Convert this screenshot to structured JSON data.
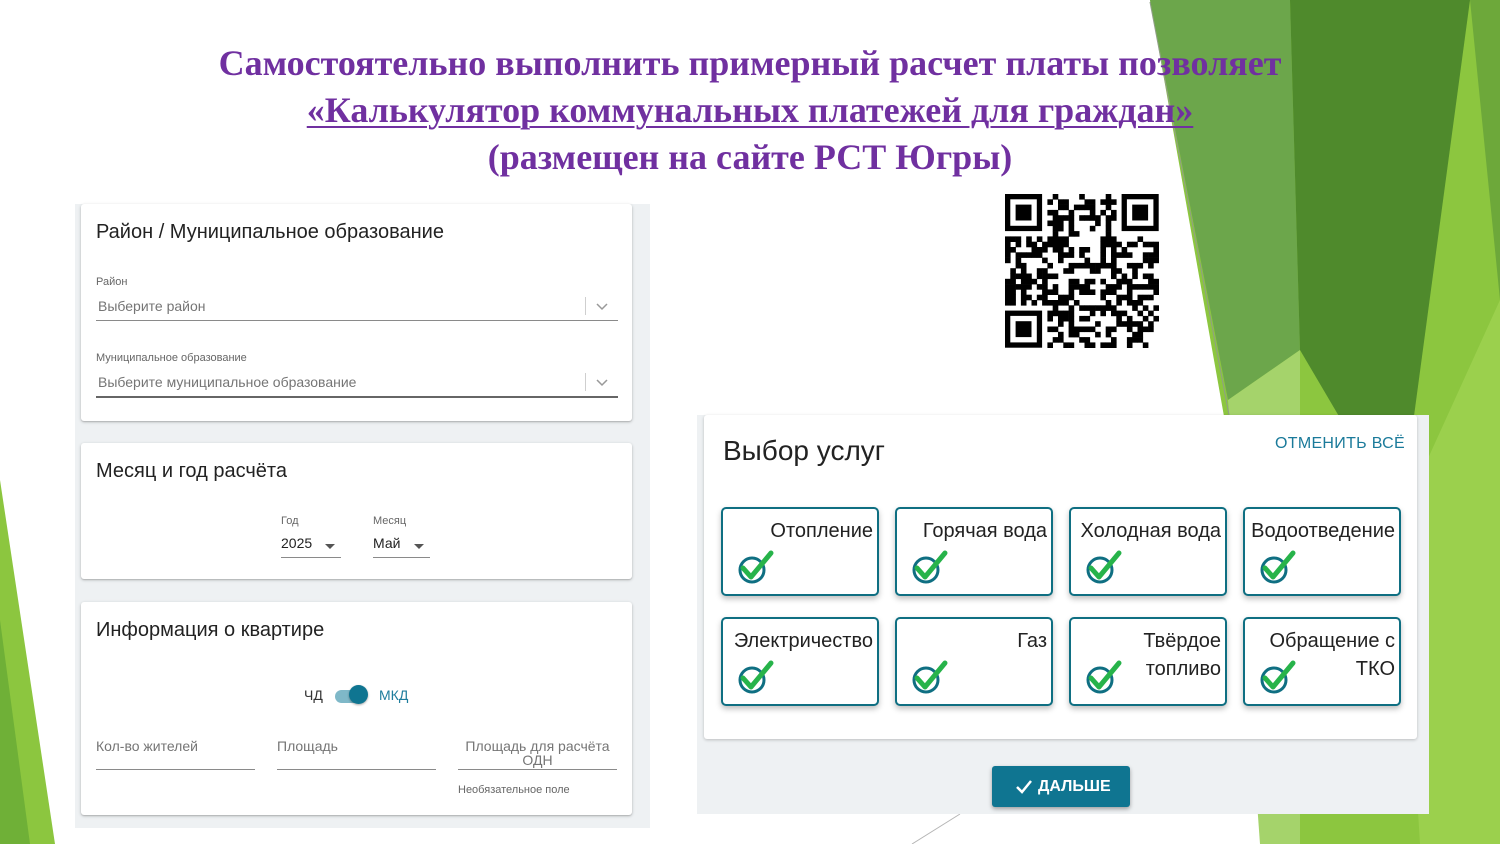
{
  "slide": {
    "title_line1": "Самостоятельно выполнить примерный расчет платы позволяет",
    "title_link": "«Калькулятор коммунальных платежей для граждан»",
    "title_line3": "(размещен на сайте РСТ Югры)",
    "colors": {
      "title": "#7030a0",
      "accent_green": "#8cc63f",
      "dark_green": "#4f8a2c"
    }
  },
  "district_section": {
    "title": "Район / Муниципальное образование",
    "district": {
      "label": "Район",
      "placeholder": "Выберите район"
    },
    "municipality": {
      "label": "Муниципальное образование",
      "placeholder": "Выберите муниципальное образование"
    }
  },
  "period_section": {
    "title": "Месяц и год расчёта",
    "year": {
      "label": "Год",
      "value": "2025"
    },
    "month": {
      "label": "Месяц",
      "value": "Май"
    }
  },
  "apartment_section": {
    "title": "Информация о квартире",
    "toggle": {
      "left_label": "ЧД",
      "right_label": "МКД",
      "selected": "МКД"
    },
    "residents": {
      "label": "Кол-во жителей",
      "value": ""
    },
    "area": {
      "label": "Площадь",
      "value": ""
    },
    "odn_area": {
      "label": "Площадь для расчёта ОДН",
      "value": "",
      "hint": "Необязательное поле"
    }
  },
  "services": {
    "title": "Выбор услуг",
    "cancel_all": "ОТМЕНИТЬ ВСЁ",
    "items": [
      {
        "label": "Отопление",
        "checked": true
      },
      {
        "label": "Горячая вода",
        "checked": true
      },
      {
        "label": "Холодная вода",
        "checked": true
      },
      {
        "label": "Водоотведение",
        "checked": true
      },
      {
        "label": "Электричество",
        "checked": true
      },
      {
        "label": "Газ",
        "checked": true
      },
      {
        "label": "Твёрдое топливо",
        "checked": true
      },
      {
        "label": "Обращение с ТКО",
        "checked": true
      }
    ],
    "next_button": "ДАЛЬШЕ",
    "colors": {
      "primary": "#0f7591",
      "check_green": "#27b34a"
    }
  },
  "qr_code": {
    "icon": "qr-code-icon"
  }
}
